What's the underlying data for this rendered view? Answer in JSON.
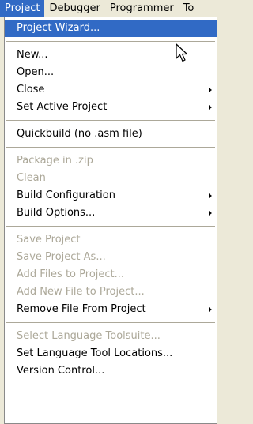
{
  "menubar": {
    "items": [
      "Project",
      "Debugger",
      "Programmer",
      "To"
    ]
  },
  "menu": {
    "group1": [
      "Project Wizard..."
    ],
    "group2": [
      "New...",
      "Open...",
      "Close",
      "Set Active Project"
    ],
    "group3": [
      "Quickbuild (no .asm file)"
    ],
    "group4": [
      "Package in .zip",
      "Clean",
      "Build Configuration",
      "Build Options..."
    ],
    "group5": [
      "Save Project",
      "Save Project As...",
      "Add Files to Project...",
      "Add New File to Project...",
      "Remove File From Project"
    ],
    "group6": [
      "Select Language Toolsuite...",
      "Set Language Tool Locations...",
      "Version Control..."
    ]
  },
  "colors": {
    "highlight": "#316ac5",
    "disabled_text": "#aca899",
    "menubar_bg": "#ece9d8"
  },
  "icons": {
    "cursor": "mouse-pointer-icon",
    "submenu": "submenu-arrow-icon"
  }
}
